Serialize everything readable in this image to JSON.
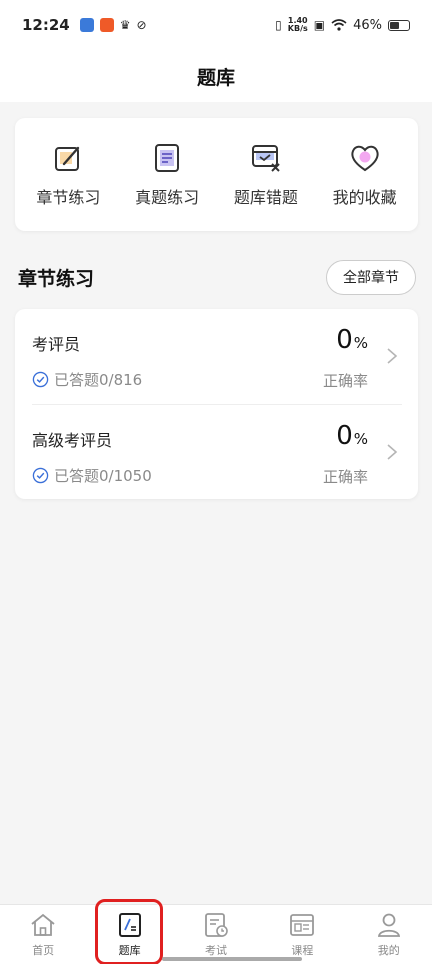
{
  "status_bar": {
    "time": "12:24",
    "net_speed_value": "1.40",
    "net_speed_unit": "KB/s",
    "battery": "46%"
  },
  "nav": {
    "title": "题库"
  },
  "shortcuts": [
    {
      "label": "章节练习",
      "icon": "edit-square-icon"
    },
    {
      "label": "真题练习",
      "icon": "document-icon"
    },
    {
      "label": "题库错题",
      "icon": "wrong-questions-icon"
    },
    {
      "label": "我的收藏",
      "icon": "heart-icon"
    }
  ],
  "section": {
    "title": "章节练习",
    "all_button": "全部章节"
  },
  "list": [
    {
      "name": "考评员",
      "answered": "已答题0/816",
      "rate": "0",
      "rate_unit": "%",
      "rate_label": "正确率"
    },
    {
      "name": "高级考评员",
      "answered": "已答题0/1050",
      "rate": "0",
      "rate_unit": "%",
      "rate_label": "正确率"
    }
  ],
  "tabs": [
    {
      "label": "首页",
      "icon": "home-icon"
    },
    {
      "label": "题库",
      "icon": "question-bank-icon"
    },
    {
      "label": "考试",
      "icon": "exam-icon"
    },
    {
      "label": "课程",
      "icon": "course-icon"
    },
    {
      "label": "我的",
      "icon": "profile-icon"
    }
  ],
  "colors": {
    "accent": "#3a6fd8",
    "highlight": "#e02020",
    "icon_purple": "#6c63c7",
    "icon_pink": "#f3a8f0"
  }
}
